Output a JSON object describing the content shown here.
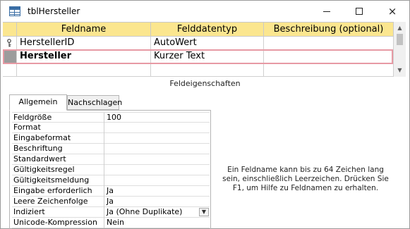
{
  "window": {
    "title": "tblHersteller",
    "icon": "table-icon",
    "controls": {
      "minimize": "minimize-icon",
      "maximize": "maximize-icon",
      "close": "×"
    }
  },
  "grid": {
    "columns": [
      "Feldname",
      "Felddatentyp",
      "Beschreibung (optional)"
    ],
    "rows": [
      {
        "feldname": "HerstellerID",
        "datentyp": "AutoWert",
        "beschreibung": "",
        "primary_key": true,
        "selected": false
      },
      {
        "feldname": "Hersteller",
        "datentyp": "Kurzer Text",
        "beschreibung": "",
        "primary_key": false,
        "selected": true
      }
    ]
  },
  "properties": {
    "section_label": "Feldeigenschaften",
    "tabs": [
      "Allgemein",
      "Nachschlagen"
    ],
    "active_tab": "Allgemein",
    "rows": [
      {
        "name": "Feldgröße",
        "value": "100"
      },
      {
        "name": "Format",
        "value": ""
      },
      {
        "name": "Eingabeformat",
        "value": ""
      },
      {
        "name": "Beschriftung",
        "value": ""
      },
      {
        "name": "Standardwert",
        "value": ""
      },
      {
        "name": "Gültigkeitsregel",
        "value": ""
      },
      {
        "name": "Gültigkeitsmeldung",
        "value": ""
      },
      {
        "name": "Eingabe erforderlich",
        "value": "Ja"
      },
      {
        "name": "Leere Zeichenfolge",
        "value": "Ja"
      },
      {
        "name": "Indiziert",
        "value": "Ja (Ohne Duplikate)"
      },
      {
        "name": "Unicode-Kompression",
        "value": "Nein"
      }
    ]
  },
  "help": {
    "text": "Ein Feldname kann bis zu 64 Zeichen lang sein, einschließlich Leerzeichen. Drücken Sie F1, um Hilfe zu Feldnamen zu erhalten."
  },
  "colors": {
    "header_bg": "#fbe68f",
    "selection_border": "#e79aa4",
    "row_selector_active": "#9c9c9c"
  }
}
